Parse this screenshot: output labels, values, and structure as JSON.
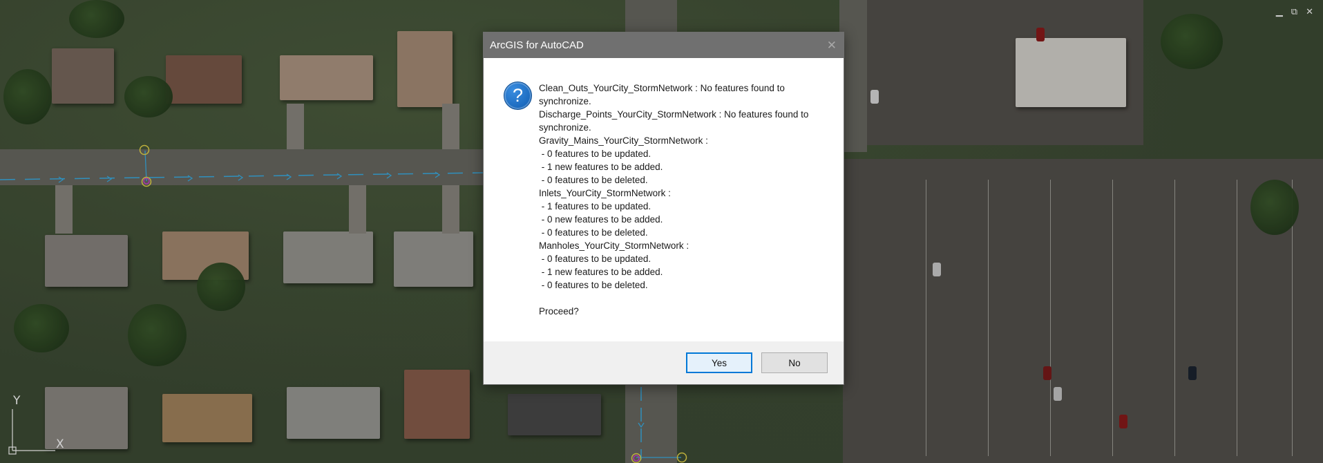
{
  "window": {
    "controls": {
      "minimize": "▁",
      "restore": "⧉",
      "close": "✕"
    }
  },
  "canvas": {
    "axis_y_label": "Y",
    "axis_x_label": "X"
  },
  "dialog": {
    "title": "ArcGIS for AutoCAD",
    "close_glyph": "✕",
    "icon": "question-icon",
    "icon_glyph": "?",
    "message_lines": [
      "Clean_Outs_YourCity_StormNetwork : No features found to",
      "synchronize.",
      "Discharge_Points_YourCity_StormNetwork : No features found to",
      "synchronize.",
      "Gravity_Mains_YourCity_StormNetwork :",
      " - 0 features to be updated.",
      " - 1 new features to be added.",
      " - 0 features to be deleted.",
      "Inlets_YourCity_StormNetwork :",
      " - 1 features to be updated.",
      " - 0 new features to be added.",
      " - 0 features to be deleted.",
      "Manholes_YourCity_StormNetwork :",
      " - 0 features to be updated.",
      " - 1 new features to be added.",
      " - 0 features to be deleted.",
      "",
      "Proceed?"
    ],
    "buttons": {
      "yes": "Yes",
      "no": "No"
    }
  },
  "colors": {
    "titlebar": "#707070",
    "accent_blue": "#0078d7",
    "cad_line": "#3ab0e8",
    "cad_node_yellow": "#e8d84a",
    "cad_node_magenta": "#d040d0"
  }
}
